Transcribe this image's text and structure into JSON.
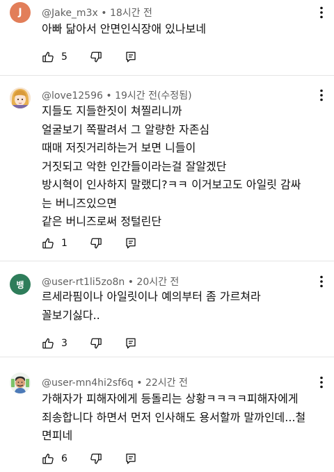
{
  "comments": [
    {
      "avatar_letter": "J",
      "avatar_color": "#e27e59",
      "author": "@Jake_m3x",
      "time": "18시간 전",
      "lines": [
        "아빠 닮아서 안면인식장애 있나보네"
      ],
      "likes": "5"
    },
    {
      "avatar_letter": "",
      "avatar_color": "#f3dcc4",
      "author": "@love12596",
      "time": "19시간 전(수정됨)",
      "lines": [
        "지들도 지들한짓이 쳐찔리니까",
        "얼굴보기 쪽팔려서 그 알량한 자존심",
        "때매 저짓거리하는거 보면 니들이",
        "거짓되고 악한 인간들이라는걸 잘알겠단",
        "방시혁이 인사하지 말랬디?ㅋㅋ 이거보고도 아일릿 감싸",
        "는 버니즈있으면",
        "같은 버니즈로써 정털린단"
      ],
      "likes": "1"
    },
    {
      "avatar_letter": "뱅",
      "avatar_color": "#2e7d5a",
      "author": "@user-rt1li5zo8n",
      "time": "20시간 전",
      "lines": [
        "르세라핌이나 아일릿이나 예의부터 좀 가르쳐라",
        "꼴보기싫다.."
      ],
      "likes": "3"
    },
    {
      "avatar_letter": "",
      "avatar_color": "#eef3ee",
      "author": "@user-mn4hi2sf6q",
      "time": "22시간 전",
      "lines": [
        "가해자가 피해자에게 등돌리는 상황ㅋㅋㅋㅋ피해자에게",
        "죄송합니다 하면서 먼저 인사해도 용서할까 말까인데...철",
        "면피네"
      ],
      "likes": "6"
    }
  ]
}
